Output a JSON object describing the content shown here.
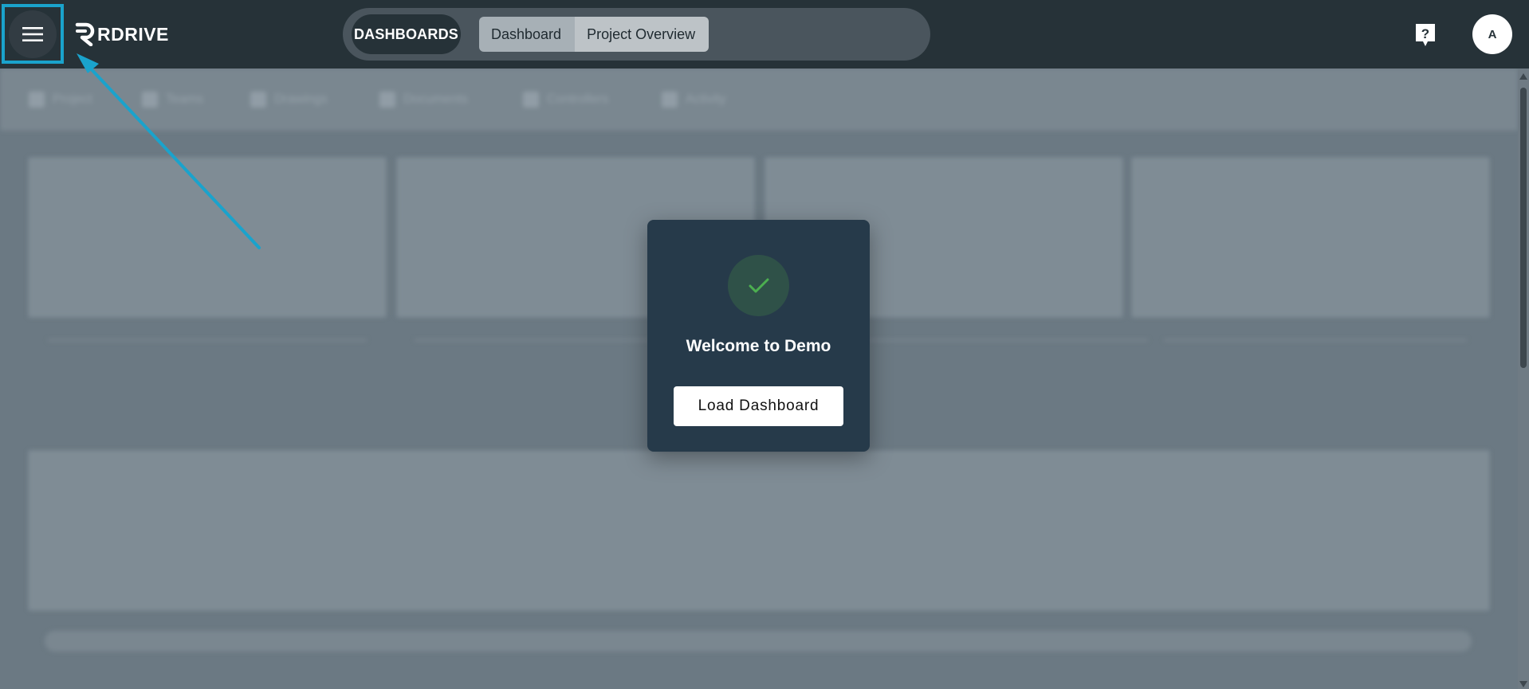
{
  "topbar": {
    "menu_icon": "hamburger-icon",
    "logo_text": "RDRIVE",
    "dashboards_label": "DASHBOARDS",
    "tabs": [
      {
        "label": "Dashboard",
        "active": true
      },
      {
        "label": "Project Overview",
        "active": false
      }
    ],
    "help_icon": "help-question-icon",
    "avatar_initial": "A"
  },
  "background": {
    "nav_items": [
      {
        "label": "Project",
        "icon": "project-icon"
      },
      {
        "label": "Teams",
        "icon": "teams-icon"
      },
      {
        "label": "Drawings",
        "icon": "drawings-icon"
      },
      {
        "label": "Documents",
        "icon": "documents-icon"
      },
      {
        "label": "Controllers",
        "icon": "controllers-icon"
      },
      {
        "label": "Activity",
        "icon": "activity-icon"
      }
    ]
  },
  "modal": {
    "icon": "check-icon",
    "title": "Welcome to Demo",
    "button_label": "Load Dashboard"
  },
  "colors": {
    "topbar_bg": "#263238",
    "highlight": "#1aa3cc",
    "modal_bg": "#263a4a",
    "check_green": "#4caf50"
  }
}
